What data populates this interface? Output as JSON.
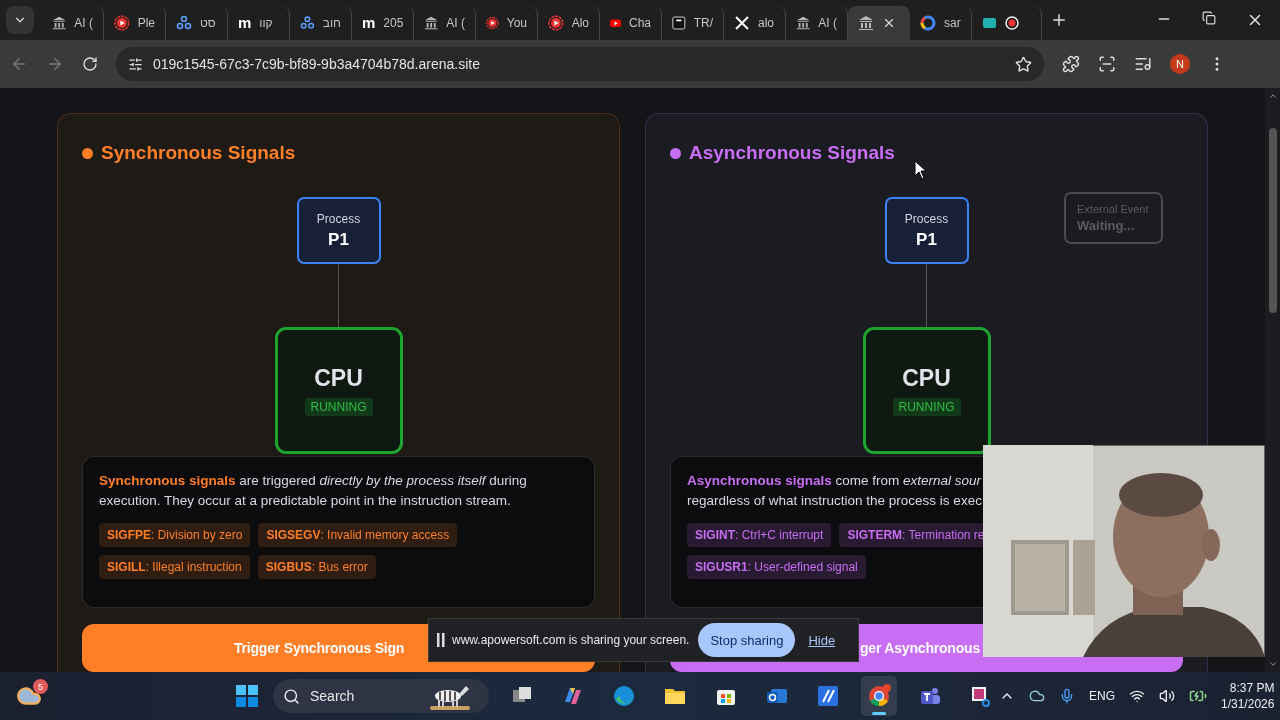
{
  "browser": {
    "tabs": [
      {
        "kind": "arena",
        "label": "AI (",
        "selected": false
      },
      {
        "kind": "yt-ring",
        "label": "Ple",
        "selected": false
      },
      {
        "kind": "network",
        "label": "סט",
        "selected": false
      },
      {
        "kind": "letter",
        "glyph": "m",
        "label": "קוו",
        "selected": false
      },
      {
        "kind": "network",
        "label": "חוב",
        "selected": false
      },
      {
        "kind": "letter",
        "glyph": "m",
        "label": "205",
        "selected": false
      },
      {
        "kind": "arena",
        "label": "AI (",
        "selected": false
      },
      {
        "kind": "yt-ring",
        "label": "You",
        "selected": false
      },
      {
        "kind": "yt-ring",
        "label": "Alo",
        "selected": false
      },
      {
        "kind": "youtube",
        "label": "Cha",
        "selected": false
      },
      {
        "kind": "square",
        "label": "TR/",
        "selected": false
      },
      {
        "kind": "x",
        "label": "alo",
        "selected": false
      },
      {
        "kind": "arena",
        "label": "AI (",
        "selected": false
      },
      {
        "kind": "arena",
        "selected": true
      },
      {
        "kind": "google",
        "label": "sar",
        "selected": false
      },
      {
        "kind": "recorder",
        "selected": false
      }
    ],
    "address": "019c1545-67c3-7c9b-bf89-9b3a4704b78d.arena.site",
    "profile": "N"
  },
  "cards": [
    {
      "title": "Synchronous Signals",
      "color": "#ff7f27",
      "process": {
        "label": "Process",
        "name": "P1"
      },
      "cpu": {
        "name": "CPU",
        "status": "RUNNING"
      },
      "description": "**Synchronous signals** are triggered *directly by the process itself* during\nexecution. They occur at a predictable point in the instruction stream.",
      "tags": [
        "**SIGFPE**: Division by zero",
        "**SIGSEGV**: Invalid memory access",
        "**SIGILL**: Illegal instruction",
        "**SIGBUS**: Bus error"
      ],
      "button": "Trigger Synchronous Sign"
    },
    {
      "title": "Asynchronous Signals",
      "color": "#c86ef5",
      "process": {
        "label": "Process",
        "name": "P1"
      },
      "cpu": {
        "name": "CPU",
        "status": "RUNNING"
      },
      "external_event": {
        "label": "External Event",
        "status": "Waiting...",
        "active": false
      },
      "description": "**Asynchronous signals** come from *external sour*\nregardless of what instruction the process is exec",
      "tags": [
        "**SIGINT**: Ctrl+C interrupt",
        "**SIGTERM**: Termination re",
        "**SIGUSR1**: User-defined signal"
      ],
      "button": "ger Asynchronous"
    }
  ],
  "share_bar": {
    "message": "www.apowersoft.com is sharing your screen.",
    "stop": "Stop sharing",
    "hide": "Hide"
  },
  "taskbar": {
    "weather_badge": "5",
    "search": {
      "placeholder": "Search"
    },
    "apps": [
      {
        "kind": "task-view",
        "selected": false
      },
      {
        "kind": "copilot",
        "selected": false
      },
      {
        "kind": "edge",
        "selected": false
      },
      {
        "kind": "folder",
        "selected": false
      },
      {
        "kind": "store",
        "selected": false
      },
      {
        "kind": "mail",
        "selected": false
      },
      {
        "kind": "editor",
        "selected": false
      },
      {
        "kind": "chrome",
        "selected": true
      },
      {
        "kind": "teams",
        "selected": false
      },
      {
        "kind": "snip",
        "selected": false
      }
    ],
    "language": "ENG",
    "time": "8:37 PM",
    "date": "1/31/2026"
  }
}
